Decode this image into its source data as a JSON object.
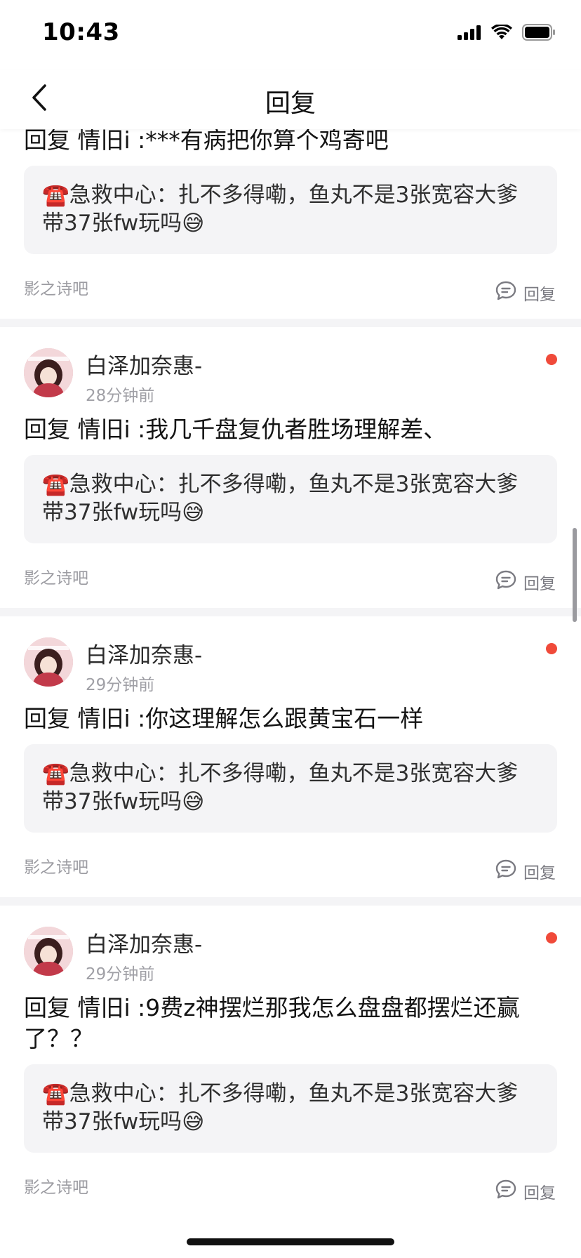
{
  "status_bar": {
    "time": "10:43"
  },
  "nav": {
    "title": "回复"
  },
  "items": [
    {
      "reply_text": "回复 情旧i :***有病把你算个鸡寄吧",
      "quote_text": "☎️急救中心：扎不多得嘞，鱼丸不是3张宽容大爹带37张fw玩吗😅",
      "forum": "影之诗吧",
      "reply_label": "回复"
    },
    {
      "username": "白泽加奈惠-",
      "time": "28分钟前",
      "reply_text": "回复 情旧i :我几千盘复仇者胜场理解差、",
      "quote_text": "☎️急救中心：扎不多得嘞，鱼丸不是3张宽容大爹带37张fw玩吗😅",
      "forum": "影之诗吧",
      "reply_label": "回复"
    },
    {
      "username": "白泽加奈惠-",
      "time": "29分钟前",
      "reply_text": "回复 情旧i :你这理解怎么跟黄宝石一样",
      "quote_text": "☎️急救中心：扎不多得嘞，鱼丸不是3张宽容大爹带37张fw玩吗😅",
      "forum": "影之诗吧",
      "reply_label": "回复"
    },
    {
      "username": "白泽加奈惠-",
      "time": "29分钟前",
      "reply_text": "回复 情旧i :9费z神摆烂那我怎么盘盘都摆烂还赢了？？",
      "quote_text": "☎️急救中心：扎不多得嘞，鱼丸不是3张宽容大爹带37张fw玩吗😅",
      "forum": "影之诗吧",
      "reply_label": "回复"
    }
  ],
  "colors": {
    "unread_dot": "#f04a3a",
    "quote_bg": "#f4f4f6",
    "separator": "#f4f4f6"
  }
}
